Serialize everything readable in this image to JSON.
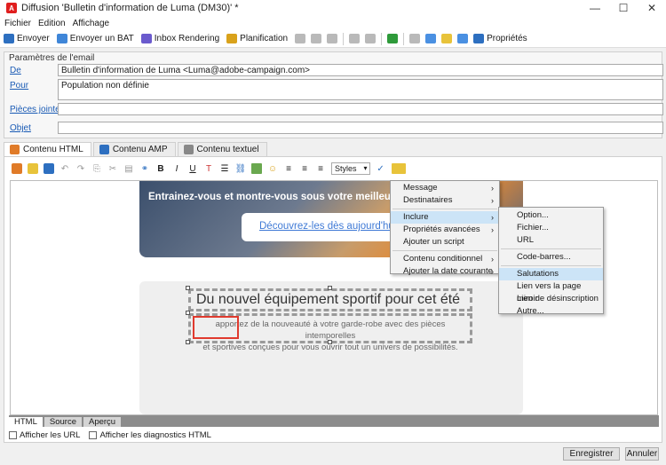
{
  "window": {
    "title": "Diffusion 'Bulletin d'information de Luma (DM30)' *",
    "controls": {
      "minimize": "—",
      "maximize": "☐",
      "close": "✕"
    }
  },
  "menubar": {
    "items": [
      "Fichier",
      "Edition",
      "Affichage"
    ]
  },
  "toolbar": {
    "envoyer": "Envoyer",
    "envoyer_bat": "Envoyer un BAT",
    "inbox_rendering": "Inbox Rendering",
    "planification": "Planification",
    "proprietes": "Propriétés"
  },
  "params": {
    "title": "Paramètres de l'email",
    "de_label": "De",
    "de_value": "Bulletin d'information de Luma <Luma@adobe-campaign.com>",
    "pour_label": "Pour",
    "pour_value": "Population non définie",
    "pj_label": "Pièces jointes",
    "objet_label": "Objet"
  },
  "tabs": {
    "html": "Contenu HTML",
    "amp": "Contenu AMP",
    "texte": "Contenu textuel"
  },
  "editor": {
    "bold": "B",
    "italic": "I",
    "underline": "U",
    "styles": "Styles"
  },
  "content": {
    "hero_text": "Entrainez-vous et montre-vous sous votre meilleur jour c",
    "hero_button": "Découvrez-les dès aujourd'hui",
    "headline": "Du nouvel équipement sportif pour cet été",
    "paragraph_line1": "apportez de la nouveauté à votre garde-robe avec des pièces intemporelles",
    "paragraph_line2": "et sportives conçues pour vous ouvrir tout un univers de possibilités."
  },
  "context_menu": {
    "message": "Message",
    "destinataires": "Destinataires",
    "inclure": "Inclure",
    "proprietes_avancees": "Propriétés avancées",
    "ajouter_script": "Ajouter un script",
    "contenu_conditionnel": "Contenu conditionnel",
    "ajouter_date": "Ajouter la date courante"
  },
  "submenu": {
    "option": "Option...",
    "fichier": "Fichier...",
    "url": "URL",
    "code_barres": "Code-barres...",
    "salutations": "Salutations",
    "lien_miroir": "Lien vers la page miroir",
    "lien_desinscription": "Lien de désinscription",
    "autre": "Autre..."
  },
  "bottom_tabs": {
    "html": "HTML",
    "source": "Source",
    "apercu": "Aperçu"
  },
  "checks": {
    "urls": "Afficher les URL",
    "diagnostics": "Afficher les diagnostics HTML"
  },
  "footer": {
    "enregistrer": "Enregistrer",
    "annuler": "Annuler"
  }
}
